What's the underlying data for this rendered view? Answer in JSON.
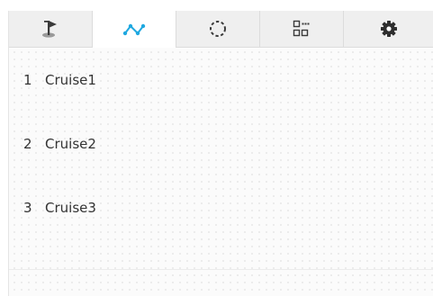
{
  "tabs": [
    {
      "icon": "golf-flag-icon",
      "active": false
    },
    {
      "icon": "zigzag-path-icon",
      "active": true,
      "color": "#1fa8e0"
    },
    {
      "icon": "dotted-circle-icon",
      "active": false
    },
    {
      "icon": "grid-pattern-icon",
      "active": false
    },
    {
      "icon": "gear-icon",
      "active": false
    }
  ],
  "cruises": [
    {
      "number": "1",
      "name": "Cruise1"
    },
    {
      "number": "2",
      "name": "Cruise2"
    },
    {
      "number": "3",
      "name": "Cruise3"
    }
  ]
}
